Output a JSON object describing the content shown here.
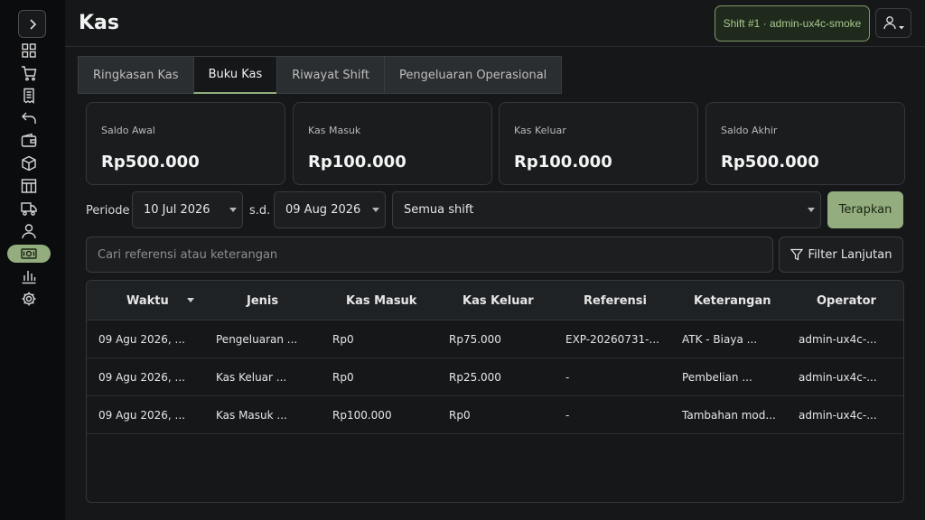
{
  "header": {
    "title": "Kas",
    "shift_badge": "Shift #1 · admin-ux4c-smoke"
  },
  "sidebar": {
    "items": [
      {
        "icon": "dashboard-grid-icon"
      },
      {
        "icon": "cart-icon"
      },
      {
        "icon": "receipt-icon"
      },
      {
        "icon": "return-icon"
      },
      {
        "icon": "wallet-icon"
      },
      {
        "icon": "box-icon"
      },
      {
        "icon": "table-icon"
      },
      {
        "icon": "truck-icon"
      },
      {
        "icon": "user-icon"
      },
      {
        "icon": "cash-icon",
        "active": true
      },
      {
        "icon": "bar-chart-icon"
      },
      {
        "icon": "settings-icon"
      }
    ]
  },
  "tabs": [
    {
      "label": "Ringkasan Kas",
      "active": false
    },
    {
      "label": "Buku Kas",
      "active": true
    },
    {
      "label": "Riwayat Shift",
      "active": false
    },
    {
      "label": "Pengeluaran Operasional",
      "active": false
    }
  ],
  "summary": [
    {
      "label": "Saldo Awal",
      "value": "Rp500.000"
    },
    {
      "label": "Kas Masuk",
      "value": "Rp100.000"
    },
    {
      "label": "Kas Keluar",
      "value": "Rp100.000"
    },
    {
      "label": "Saldo Akhir",
      "value": "Rp500.000"
    }
  ],
  "filters": {
    "periode_label": "Periode",
    "date_from": "10 Jul 2026",
    "sd_label": "s.d.",
    "date_to": "09 Aug 2026",
    "shift_select": "Semua shift",
    "apply_label": "Terapkan",
    "search_placeholder": "Cari referensi atau keterangan",
    "advanced_label": "Filter Lanjutan"
  },
  "table": {
    "columns": [
      "Waktu",
      "Jenis",
      "Kas Masuk",
      "Kas Keluar",
      "Referensi",
      "Keterangan",
      "Operator"
    ],
    "rows": [
      [
        "09 Agu 2026, ...",
        "Pengeluaran ...",
        "Rp0",
        "Rp75.000",
        "EXP-20260731-...",
        "ATK - Biaya ...",
        "admin-ux4c-..."
      ],
      [
        "09 Agu 2026, ...",
        "Kas Keluar ...",
        "Rp0",
        "Rp25.000",
        "-",
        "Pembelian ...",
        "admin-ux4c-..."
      ],
      [
        "09 Agu 2026, ...",
        "Kas Masuk ...",
        "Rp100.000",
        "Rp0",
        "-",
        "Tambahan mod...",
        "admin-ux4c-..."
      ]
    ]
  },
  "colors": {
    "accent": "#93ad7e",
    "background": "#151718",
    "sidebar": "#0b0c0d"
  }
}
